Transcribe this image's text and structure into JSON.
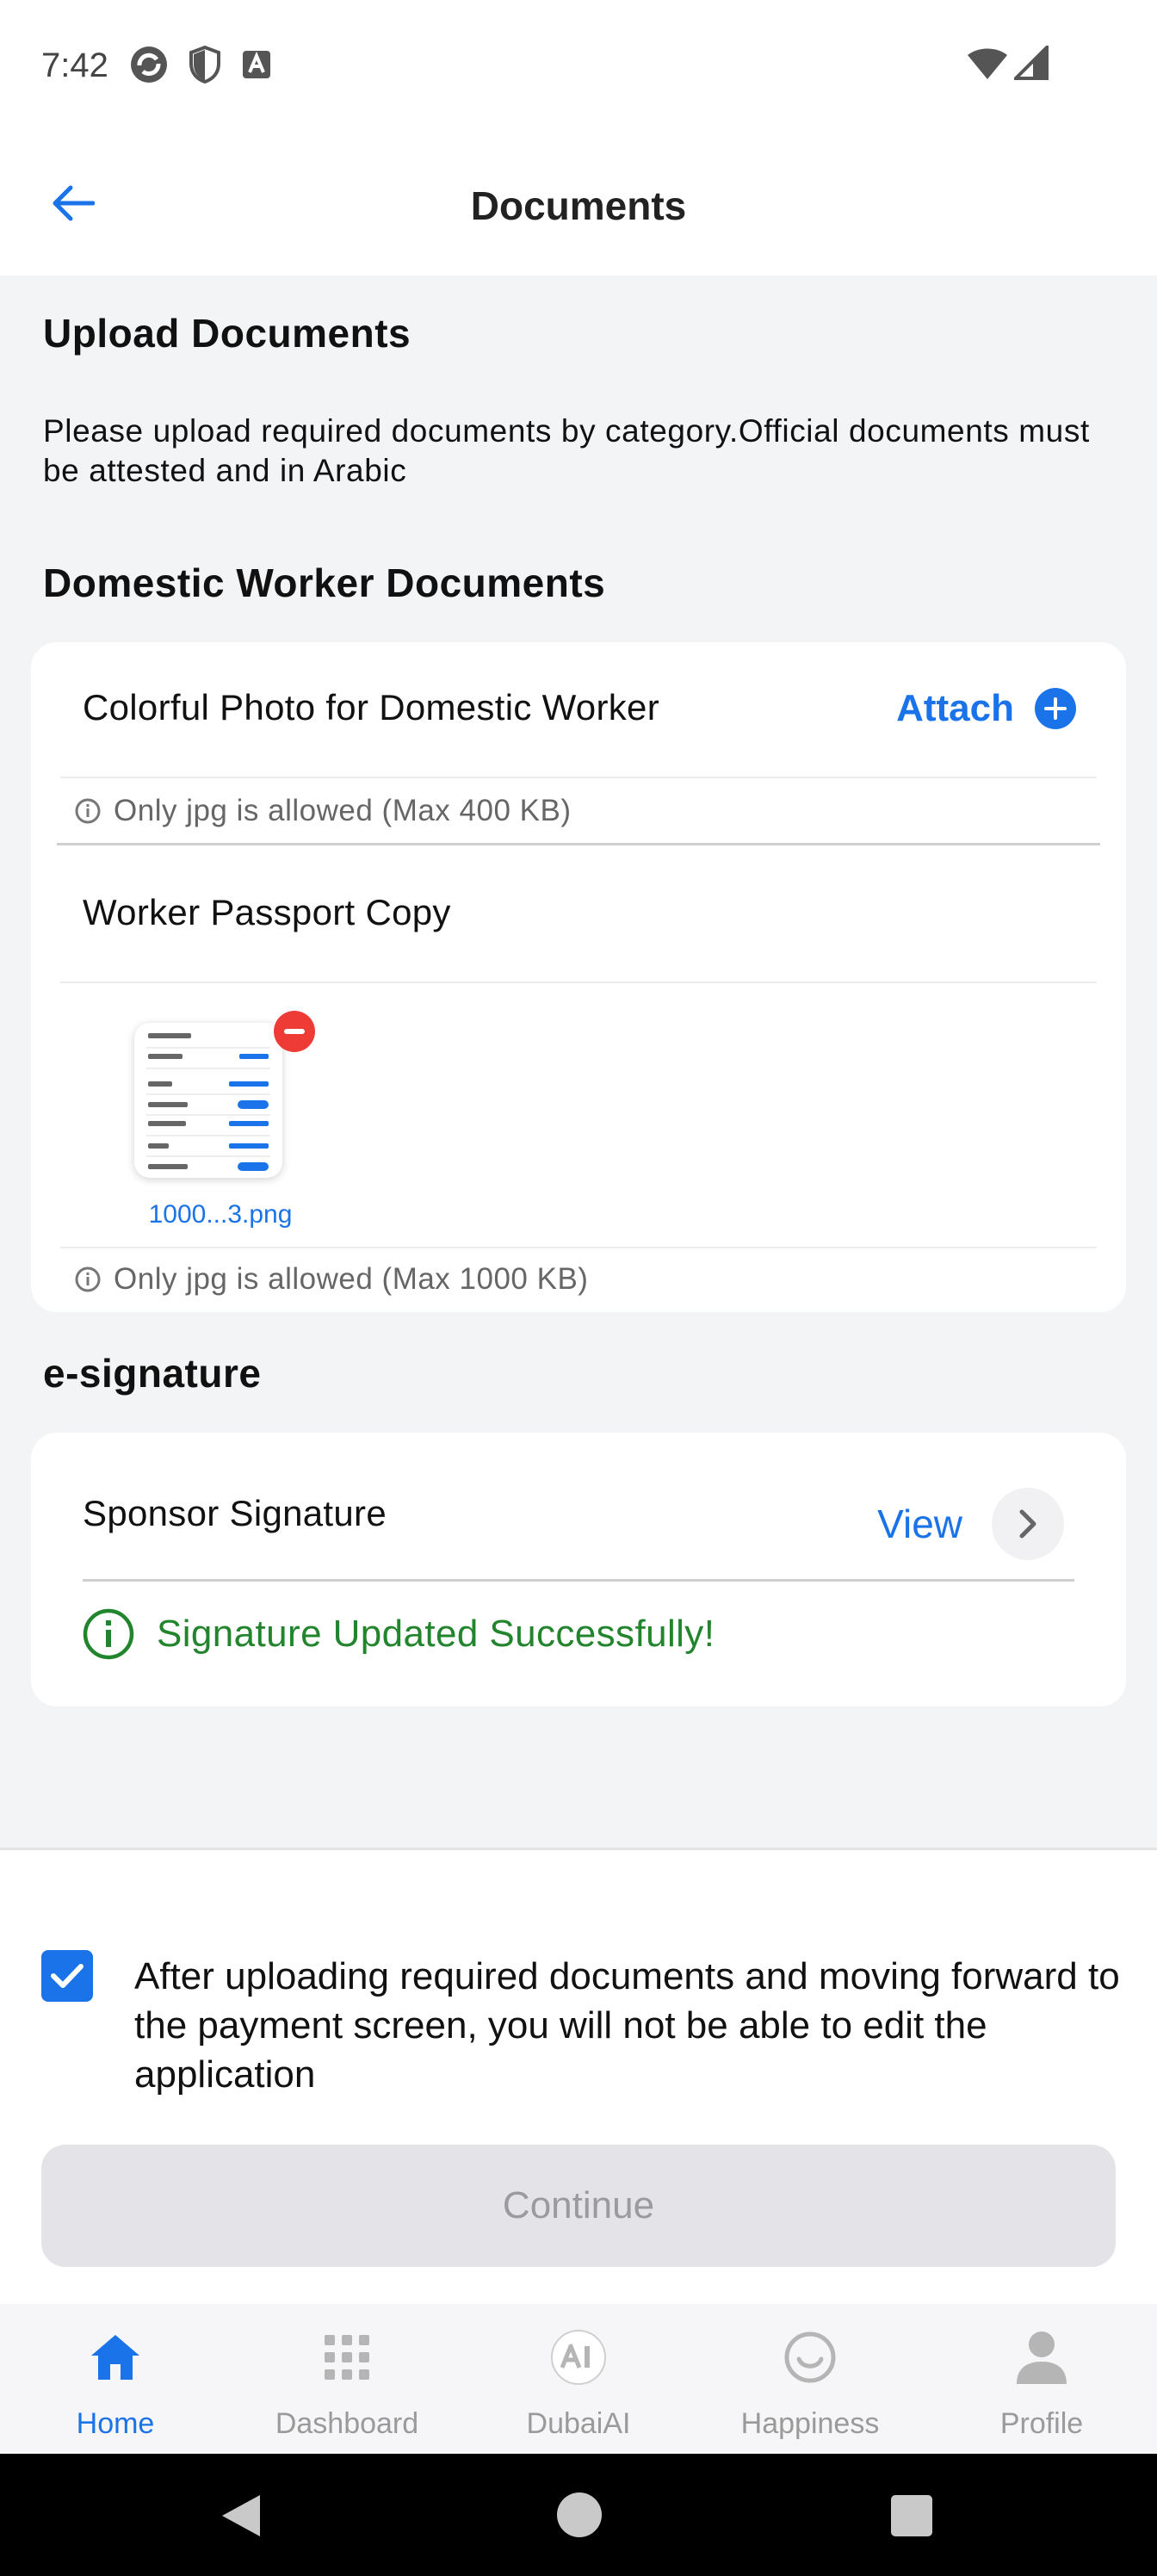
{
  "status_bar": {
    "time": "7:42"
  },
  "header": {
    "title": "Documents"
  },
  "upload": {
    "heading": "Upload Documents",
    "description": "Please upload required documents by category.Official documents must be attested and in Arabic"
  },
  "worker_docs": {
    "heading": "Domestic Worker Documents",
    "photo": {
      "label": "Colorful Photo for Domestic Worker",
      "attach_label": "Attach",
      "hint": "Only jpg is allowed (Max 400 KB)"
    },
    "passport": {
      "label": "Worker Passport Copy",
      "file_name": "1000...3.png",
      "hint": "Only jpg is allowed (Max 1000 KB)"
    }
  },
  "esignature": {
    "heading": "e-signature",
    "sponsor_label": "Sponsor Signature",
    "view_label": "View",
    "success_message": "Signature Updated Successfully!"
  },
  "consent": {
    "checked": true,
    "text": "After uploading required documents and moving forward to the payment screen, you will not be able to edit the application"
  },
  "continue_label": "Continue",
  "bottom_nav": {
    "items": [
      {
        "label": "Home",
        "icon": "home-icon",
        "active": true
      },
      {
        "label": "Dashboard",
        "icon": "grid-icon",
        "active": false
      },
      {
        "label": "DubaiAI",
        "icon": "ai-icon",
        "active": false
      },
      {
        "label": "Happiness",
        "icon": "smiley-icon",
        "active": false
      },
      {
        "label": "Profile",
        "icon": "person-icon",
        "active": false
      }
    ]
  },
  "colors": {
    "accent": "#1a73e8",
    "success": "#22852d",
    "danger": "#ee3b36"
  }
}
